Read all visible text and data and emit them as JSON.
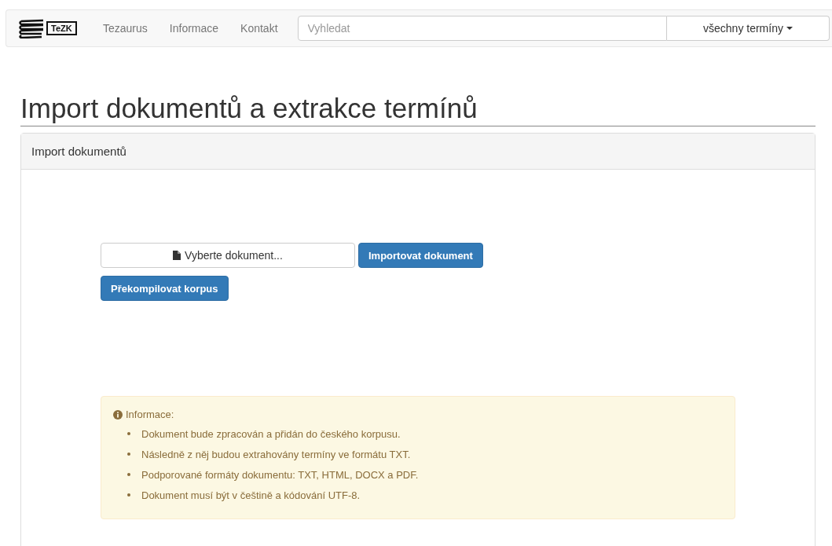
{
  "navbar": {
    "logo_text": "TeZK",
    "links": [
      "Tezaurus",
      "Informace",
      "Kontakt"
    ],
    "search": {
      "placeholder": "Vyhledat"
    },
    "filter_dropdown": "všechny termíny"
  },
  "page_title": "Import dokumentů a extrakce termínů",
  "panel": {
    "heading": "Import dokumentů",
    "file_picker": "Vyberte dokument...",
    "buttons": [
      "Importovat dokument",
      "Překompilovat korpus"
    ],
    "info": {
      "title": "Informace:",
      "items": [
        "Dokument bude zpracován a přidán do českého korpusu.",
        "Následně z něj budou extrahovány termíny ve formátu TXT.",
        "Podporované formáty dokumentu: TXT, HTML, DOCX a PDF.",
        "Dokument musí být v češtině a kódování UTF-8."
      ]
    }
  }
}
